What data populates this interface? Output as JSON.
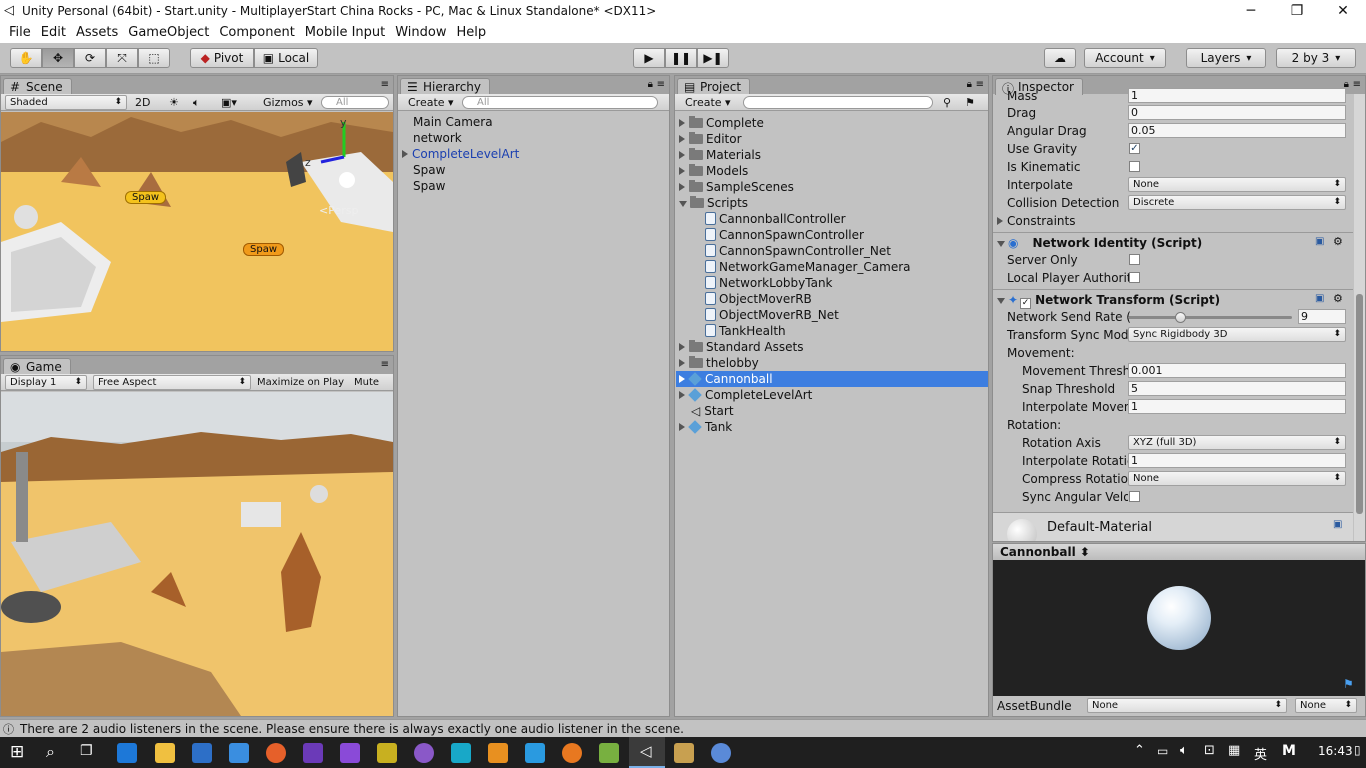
{
  "window": {
    "title": "Unity Personal (64bit) - Start.unity - MultiplayerStart China Rocks - PC, Mac & Linux Standalone* <DX11>"
  },
  "menu": [
    "File",
    "Edit",
    "Assets",
    "GameObject",
    "Component",
    "Mobile Input",
    "Window",
    "Help"
  ],
  "toolbar": {
    "pivot": "Pivot",
    "local": "Local",
    "account": "Account",
    "layers": "Layers",
    "layout": "2 by 3"
  },
  "scene": {
    "tab": "Scene",
    "shading": "Shaded",
    "mode2d": "2D",
    "gizmos": "Gizmos",
    "search_placeholder": "All",
    "persp": "<Persp",
    "axis_y": "y",
    "axis_z": "z",
    "spawn_label": "Spaw"
  },
  "game": {
    "tab": "Game",
    "display": "Display 1",
    "aspect": "Free Aspect",
    "maximize": "Maximize on Play",
    "mute": "Mute au"
  },
  "hierarchy": {
    "tab": "Hierarchy",
    "create": "Create",
    "search_placeholder": "All",
    "items": [
      "Main Camera",
      "network",
      "CompleteLevelArt",
      "Spaw",
      "Spaw"
    ]
  },
  "project": {
    "tab": "Project",
    "create": "Create",
    "folders_top": [
      "Complete",
      "Editor",
      "Materials",
      "Models",
      "SampleScenes"
    ],
    "scripts_folder": "Scripts",
    "scripts": [
      "CannonballController",
      "CannonSpawnController",
      "CannonSpawnController_Net",
      "NetworkGameManager_Camera",
      "NetworkLobbyTank",
      "ObjectMoverRB",
      "ObjectMoverRB_Net",
      "TankHealth"
    ],
    "folders_bottom": [
      "Standard Assets",
      "thelobby"
    ],
    "assets": [
      "Cannonball",
      "CompleteLevelArt",
      "Start",
      "Tank"
    ]
  },
  "inspector": {
    "tab": "Inspector",
    "mass": {
      "label": "Mass",
      "value": "1"
    },
    "drag": {
      "label": "Drag",
      "value": "0"
    },
    "angular_drag": {
      "label": "Angular Drag",
      "value": "0.05"
    },
    "use_gravity": {
      "label": "Use Gravity",
      "checked": true
    },
    "is_kinematic": {
      "label": "Is Kinematic",
      "checked": false
    },
    "interpolate": {
      "label": "Interpolate",
      "value": "None"
    },
    "collision": {
      "label": "Collision Detection",
      "value": "Discrete"
    },
    "constraints": "Constraints",
    "net_identity": {
      "title": "Network Identity (Script)",
      "server_only": "Server Only",
      "local_player": "Local Player Authorit"
    },
    "net_transform": {
      "title": "Network Transform (Script)",
      "send_rate_label": "Network Send Rate (",
      "send_rate": "9",
      "sync_mode_label": "Transform Sync Mod",
      "sync_mode": "Sync Rigidbody 3D",
      "movement": "Movement:",
      "move_thresh_label": "Movement Thresh",
      "move_thresh": "0.001",
      "snap_label": "Snap Threshold",
      "snap": "5",
      "interp_move_label": "Interpolate Moven",
      "interp_move": "1",
      "rotation": "Rotation:",
      "rot_axis_label": "Rotation Axis",
      "rot_axis": "XYZ (full 3D)",
      "interp_rot_label": "Interpolate Rotatic",
      "interp_rot": "1",
      "compress_label": "Compress Rotatio",
      "compress": "None",
      "sync_ang_label": "Sync Angular Velo"
    },
    "material": "Default-Material"
  },
  "preview": {
    "title": "Cannonball",
    "assetbundle": "AssetBundle",
    "bundle_none": "None",
    "variant_none": "None"
  },
  "status": {
    "message": "There are 2 audio listeners in the scene. Please ensure there is always exactly one audio listener in the scene."
  },
  "taskbar": {
    "time": "16:43",
    "ime": "英",
    "ime2": "M"
  },
  "colors": {
    "selection": "#3d7ee0",
    "panel": "#c2c2c2",
    "link_blue": "#1a3fb0"
  }
}
